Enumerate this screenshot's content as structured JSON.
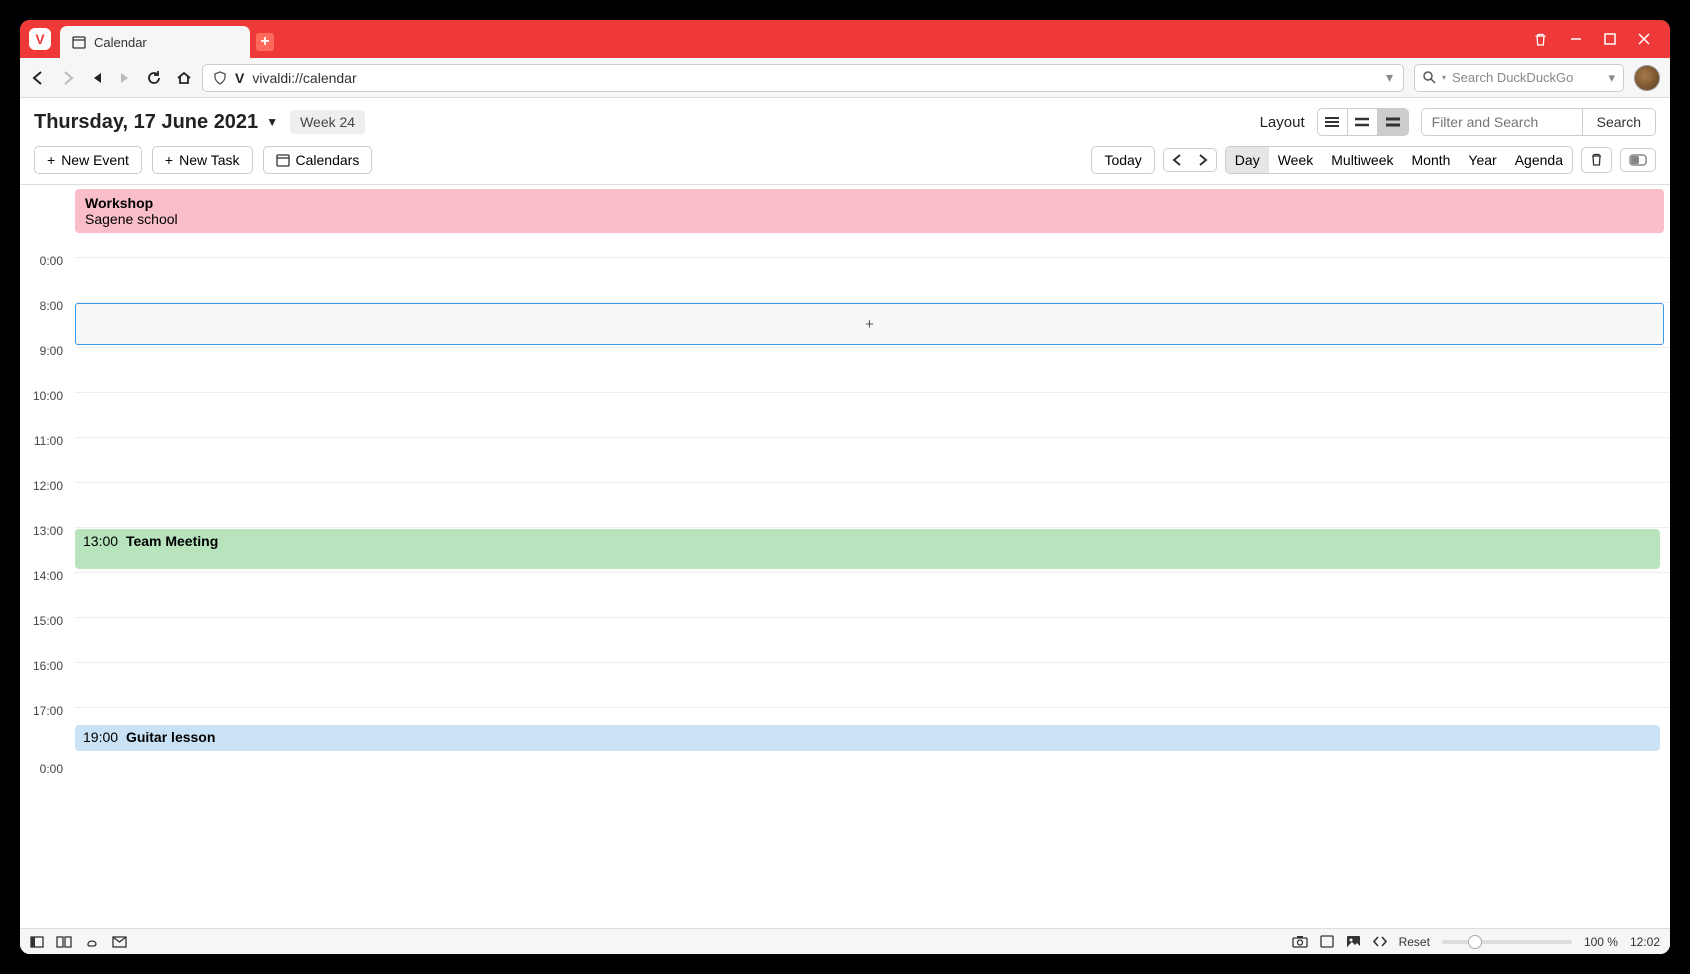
{
  "tab": {
    "title": "Calendar"
  },
  "address": {
    "url": "vivaldi://calendar"
  },
  "search": {
    "placeholder": "Search DuckDuckGo"
  },
  "header": {
    "date_title": "Thursday, 17 June 2021",
    "week_badge": "Week 24",
    "layout_label": "Layout",
    "filter_placeholder": "Filter and Search",
    "search_button": "Search"
  },
  "toolbar": {
    "new_event": "New Event",
    "new_task": "New Task",
    "calendars": "Calendars",
    "today": "Today"
  },
  "views": {
    "day": "Day",
    "week": "Week",
    "multiweek": "Multiweek",
    "month": "Month",
    "year": "Year",
    "agenda": "Agenda"
  },
  "allday_event": {
    "title": "Workshop",
    "location": "Sagene school"
  },
  "hours_top": [
    "0:00",
    "8:00",
    "9:00",
    "10:00",
    "11:00",
    "12:00",
    "13:00",
    "14:00",
    "15:00",
    "16:00",
    "17:00"
  ],
  "bottom_label": "0:00",
  "events": [
    {
      "time": "13:00",
      "title": "Team Meeting"
    },
    {
      "time": "19:00",
      "title": "Guitar lesson"
    }
  ],
  "status": {
    "reset": "Reset",
    "zoom": "100 %",
    "clock": "12:02"
  }
}
